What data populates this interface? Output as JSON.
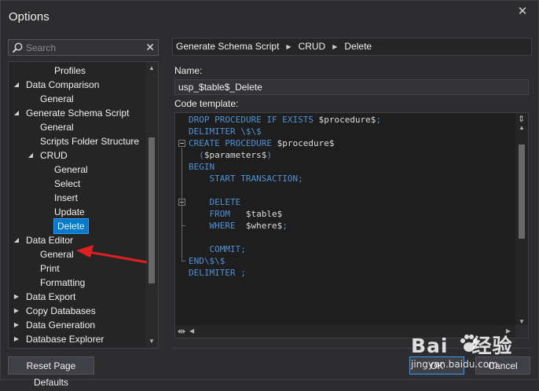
{
  "window": {
    "title": "Options",
    "close_glyph": "✕"
  },
  "search": {
    "placeholder": "Search",
    "value": "",
    "clear_glyph": "✕"
  },
  "tree": {
    "items": [
      {
        "label": "Profiles",
        "indent": 3,
        "expander": ""
      },
      {
        "label": "Data Comparison",
        "indent": 1,
        "expander": "expanded"
      },
      {
        "label": "General",
        "indent": 2,
        "expander": ""
      },
      {
        "label": "Generate Schema Script",
        "indent": 1,
        "expander": "expanded"
      },
      {
        "label": "General",
        "indent": 2,
        "expander": ""
      },
      {
        "label": "Scripts Folder Structure",
        "indent": 2,
        "expander": ""
      },
      {
        "label": "CRUD",
        "indent": 2,
        "expander": "expanded"
      },
      {
        "label": "General",
        "indent": 3,
        "expander": ""
      },
      {
        "label": "Select",
        "indent": 3,
        "expander": ""
      },
      {
        "label": "Insert",
        "indent": 3,
        "expander": ""
      },
      {
        "label": "Update",
        "indent": 3,
        "expander": ""
      },
      {
        "label": "Delete",
        "indent": 3,
        "expander": "",
        "selected": true
      },
      {
        "label": "Data Editor",
        "indent": 1,
        "expander": "expanded"
      },
      {
        "label": "General",
        "indent": 2,
        "expander": ""
      },
      {
        "label": "Print",
        "indent": 2,
        "expander": ""
      },
      {
        "label": "Formatting",
        "indent": 2,
        "expander": ""
      },
      {
        "label": "Data Export",
        "indent": 1,
        "expander": "collapsed"
      },
      {
        "label": "Copy Databases",
        "indent": 1,
        "expander": "collapsed"
      },
      {
        "label": "Data Generation",
        "indent": 1,
        "expander": "collapsed"
      },
      {
        "label": "Database Explorer",
        "indent": 1,
        "expander": "collapsed"
      }
    ],
    "scroll_position": 0.55
  },
  "reset_button": "Reset Page Defaults",
  "breadcrumb": [
    "Generate Schema Script",
    "CRUD",
    "Delete"
  ],
  "name_label": "Name:",
  "name_value": "usp_$table$_Delete",
  "code_label": "Code template:",
  "code_lines": [
    "DROP PROCEDURE IF EXISTS $procedure$;",
    "DELIMITER \\$\\$",
    "CREATE PROCEDURE $procedure$",
    "  ($parameters$)",
    "BEGIN",
    "    START TRANSACTION;",
    "",
    "    DELETE",
    "    FROM   $table$",
    "    WHERE  $where$;",
    "",
    "    COMMIT;",
    "END\\$\\$",
    "DELIMITER ;"
  ],
  "buttons": {
    "ok": "OK",
    "cancel": "Cancel"
  },
  "watermark": {
    "logo_left": "Bai",
    "logo_right": "经验",
    "url": "jingyan.baidu.com"
  },
  "colors": {
    "keyword": "#4f91d6",
    "variable": "#dcdcdc",
    "selection": "#007acc",
    "annotation_arrow": "#e02020"
  },
  "icons": [
    "search-icon",
    "close-icon",
    "clear-icon",
    "expander-arrow-icon",
    "split-icon",
    "paw-icon"
  ]
}
